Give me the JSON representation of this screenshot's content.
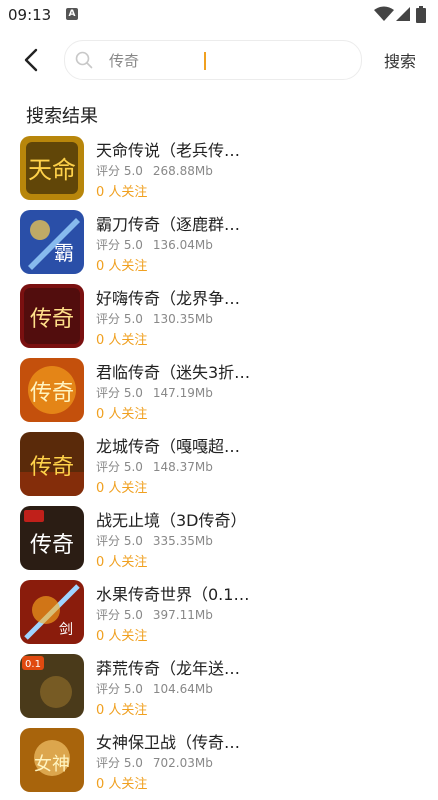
{
  "status_bar": {
    "time": "09:13",
    "notification_glyph": "A"
  },
  "search": {
    "value": "传奇",
    "button_label": "搜索"
  },
  "section_title": "搜索结果",
  "results": [
    {
      "name": "天命传说（老兵传…",
      "rating": "评分 5.0",
      "size": "268.88Mb",
      "followers": "0 人关注",
      "icon_color": "#b8860b",
      "icon_glyph": "天命"
    },
    {
      "name": "霸刀传奇（逐鹿群…",
      "rating": "评分 5.0",
      "size": "136.04Mb",
      "followers": "0 人关注",
      "icon_color": "#2a4fa8",
      "icon_glyph": "霸"
    },
    {
      "name": "好嗨传奇（龙界争…",
      "rating": "评分 5.0",
      "size": "130.35Mb",
      "followers": "0 人关注",
      "icon_color": "#7a1010",
      "icon_glyph": "传奇"
    },
    {
      "name": "君临传奇（迷失3折…",
      "rating": "评分 5.0",
      "size": "147.19Mb",
      "followers": "0 人关注",
      "icon_color": "#c4500c",
      "icon_glyph": "传奇"
    },
    {
      "name": "龙城传奇（嘎嘎超…",
      "rating": "评分 5.0",
      "size": "148.37Mb",
      "followers": "0 人关注",
      "icon_color": "#5a2a0a",
      "icon_glyph": "传奇"
    },
    {
      "name": "战无止境（3D传奇）",
      "rating": "评分 5.0",
      "size": "335.35Mb",
      "followers": "0 人关注",
      "icon_color": "#2b1d14",
      "icon_glyph": "传奇"
    },
    {
      "name": "水果传奇世界（0.1…",
      "rating": "评分 5.0",
      "size": "397.11Mb",
      "followers": "0 人关注",
      "icon_color": "#8a1c0c",
      "icon_glyph": "剑"
    },
    {
      "name": "莽荒传奇（龙年送…",
      "rating": "评分 5.0",
      "size": "104.64Mb",
      "followers": "0 人关注",
      "icon_color": "#4a3a1a",
      "icon_glyph": "0.1"
    },
    {
      "name": "女神保卫战（传奇…",
      "rating": "评分 5.0",
      "size": "702.03Mb",
      "followers": "0 人关注",
      "icon_color": "#a8640c",
      "icon_glyph": "女神"
    }
  ]
}
